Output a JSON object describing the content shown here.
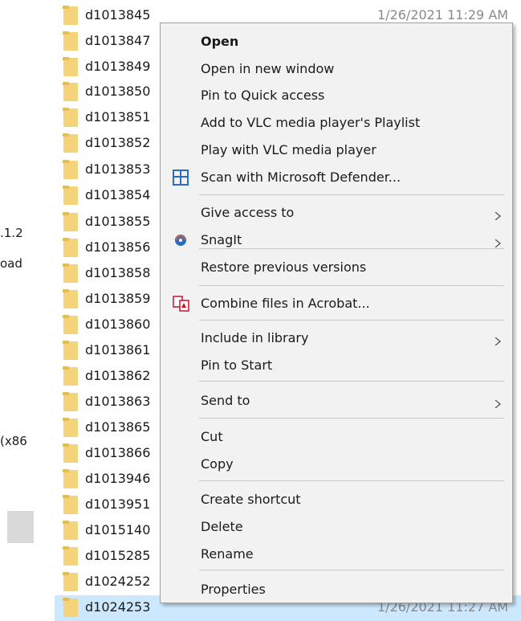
{
  "nav": {
    "frag1": ".1.2",
    "frag2": "oad",
    "frag3": "(x86"
  },
  "files": [
    {
      "name": "d1013845",
      "date": "1/26/2021 11:29 AM"
    },
    {
      "name": "d1013847"
    },
    {
      "name": "d1013849"
    },
    {
      "name": "d1013850"
    },
    {
      "name": "d1013851"
    },
    {
      "name": "d1013852"
    },
    {
      "name": "d1013853"
    },
    {
      "name": "d1013854"
    },
    {
      "name": "d1013855"
    },
    {
      "name": "d1013856"
    },
    {
      "name": "d1013858"
    },
    {
      "name": "d1013859"
    },
    {
      "name": "d1013860"
    },
    {
      "name": "d1013861"
    },
    {
      "name": "d1013862"
    },
    {
      "name": "d1013863"
    },
    {
      "name": "d1013865"
    },
    {
      "name": "d1013866"
    },
    {
      "name": "d1013946"
    },
    {
      "name": "d1013951"
    },
    {
      "name": "d1015140"
    },
    {
      "name": "d1015285"
    },
    {
      "name": "d1024252"
    },
    {
      "name": "d1024253",
      "date": "1/26/2021 11:27 AM",
      "selected": true
    }
  ],
  "context_menu": {
    "items": [
      {
        "label": "Open",
        "bold": true
      },
      {
        "label": "Open in new window"
      },
      {
        "label": "Pin to Quick access"
      },
      {
        "label": "Add to VLC media player's Playlist"
      },
      {
        "label": "Play with VLC media player"
      },
      {
        "label": "Scan with Microsoft Defender...",
        "icon": "microsoft-defender-icon"
      },
      {
        "label": "Give access to",
        "submenu": true
      },
      {
        "label": "SnagIt",
        "icon": "snagit-icon",
        "submenu": true
      },
      {
        "label": "Restore previous versions"
      },
      {
        "label": "Combine files in Acrobat...",
        "icon": "acrobat-combine-icon"
      },
      {
        "label": "Include in library",
        "submenu": true
      },
      {
        "label": "Pin to Start"
      },
      {
        "label": "Send to",
        "submenu": true
      },
      {
        "label": "Cut"
      },
      {
        "label": "Copy"
      },
      {
        "label": "Create shortcut"
      },
      {
        "label": "Delete"
      },
      {
        "label": "Rename"
      },
      {
        "label": "Properties"
      }
    ]
  },
  "colors": {
    "selection": "#cce8ff",
    "folder": "#f4d37a",
    "menu_bg": "#f2f2f2",
    "defender_blue": "#2b6cc4",
    "acrobat_red": "#c8102e"
  }
}
